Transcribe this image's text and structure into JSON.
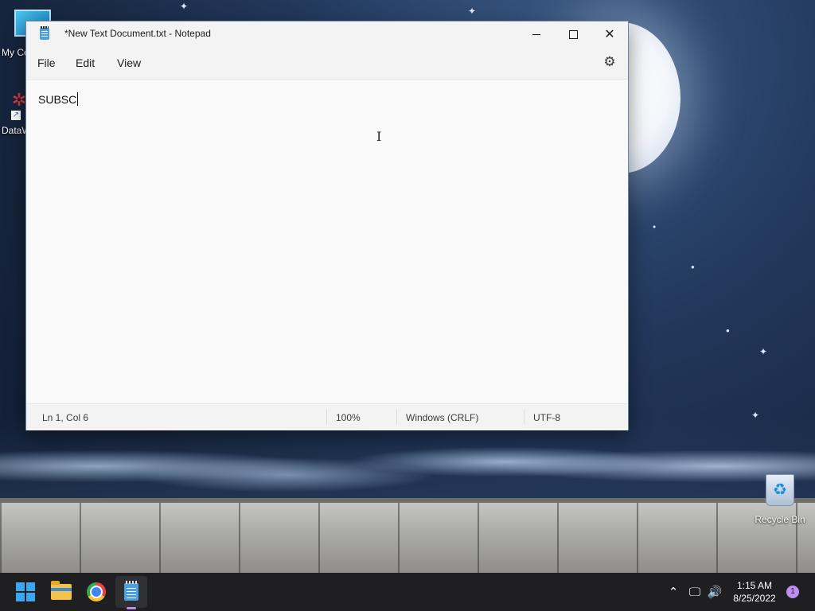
{
  "desktop": {
    "icons": [
      {
        "label": "My Co"
      },
      {
        "label": "DataW"
      },
      {
        "label": "Recycle Bin"
      }
    ]
  },
  "notepad": {
    "title": "*New Text Document.txt - Notepad",
    "menu": {
      "file": "File",
      "edit": "Edit",
      "view": "View"
    },
    "content": "SUBSC",
    "status": {
      "position": "Ln 1, Col 6",
      "zoom": "100%",
      "line_ending": "Windows (CRLF)",
      "encoding": "UTF-8"
    },
    "icons": {
      "app": "notepad-icon",
      "settings": "gear-icon"
    }
  },
  "taskbar": {
    "apps": [
      "start-icon",
      "file-explorer-icon",
      "chrome-icon",
      "notepad-icon"
    ],
    "active_app": "notepad-icon",
    "tray_icons": [
      "chevron-up-icon",
      "network-icon",
      "volume-icon"
    ],
    "clock": {
      "time": "1:15 AM",
      "date": "8/25/2022"
    },
    "notification_count": "1",
    "accent_color": "#c18cf0"
  }
}
